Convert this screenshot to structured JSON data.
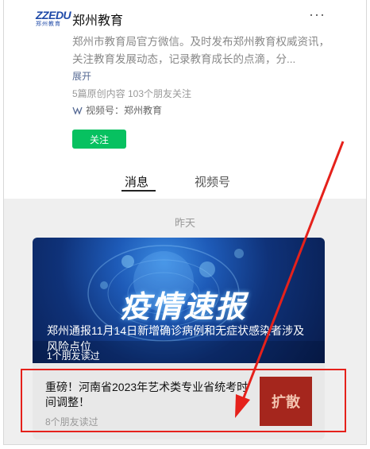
{
  "account": {
    "logo_mark": "ZZEDU",
    "logo_sub": "郑州教育",
    "name": "郑州教育",
    "more": "···",
    "description": "郑州市教育局官方微信。及时发布郑州教育权威资讯，关注教育发展动态，记录教育成长的点滴，分...",
    "expand": "展开",
    "stats": "5篇原创内容  103个朋友关注",
    "channels": "视频号：郑州教育",
    "follow": "关注"
  },
  "tabs": [
    {
      "label": "消息",
      "active": true
    },
    {
      "label": "视频号",
      "active": false
    }
  ],
  "feed": {
    "date": "昨天",
    "hero": {
      "image_text": "疫情速报",
      "readers": "1个朋友读过",
      "caption": "郑州通报11月14日新增确诊病例和无症状感染者涉及风险点位"
    },
    "article": {
      "title": "重磅！河南省2023年艺术类专业省统考时间调整！",
      "meta": "8个朋友读过",
      "thumb_text": "扩散"
    }
  },
  "colors": {
    "follow": "#07c160",
    "annotation": "#e5211b",
    "link": "#576b95"
  }
}
